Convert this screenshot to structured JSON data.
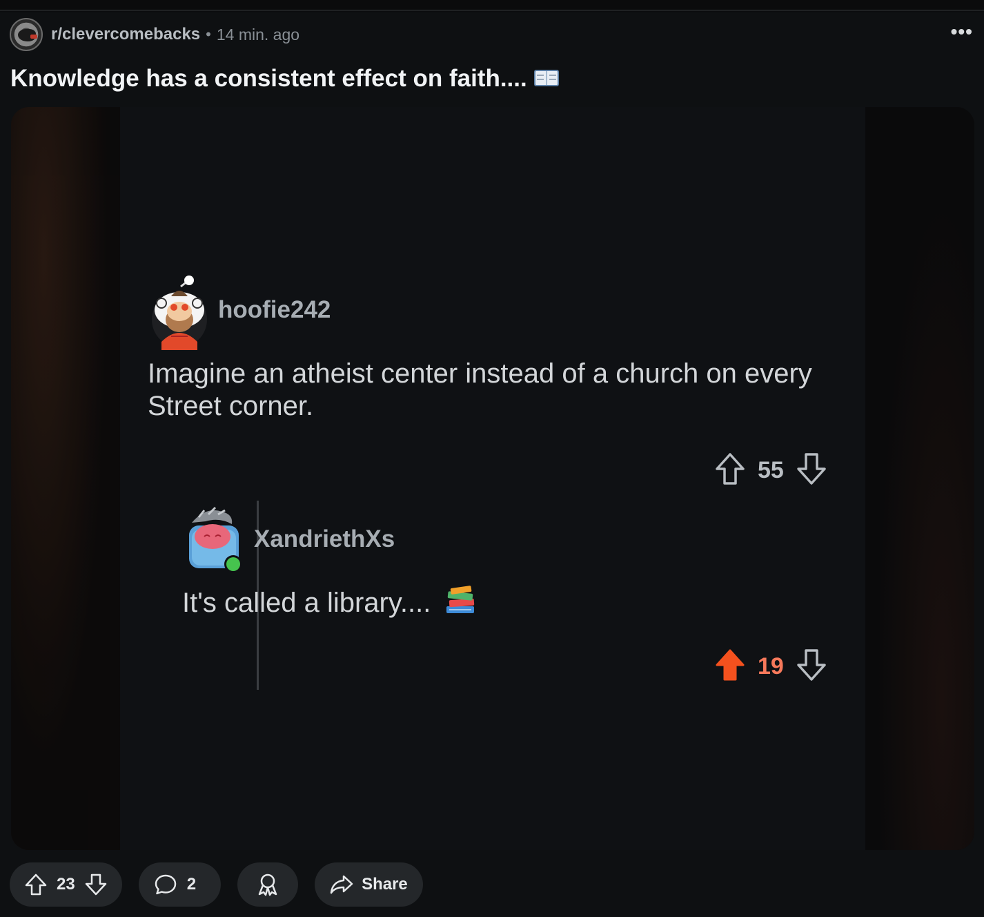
{
  "header": {
    "subreddit": "r/clevercomebacks",
    "separator": "•",
    "time": "14 min. ago",
    "more_label": "•••"
  },
  "post": {
    "title": "Knowledge has a consistent effect on faith....",
    "title_emoji_icon": "open-book-icon"
  },
  "screenshot": {
    "comment1": {
      "user": "hoofie242",
      "text_line1": "Imagine an atheist center instead of a church on every",
      "text_line2": "Street corner.",
      "votes": "55",
      "vote_state": "none"
    },
    "comment2": {
      "user": "XandriethXs",
      "text": "It's called a library....",
      "text_emoji_icon": "books-icon",
      "votes": "19",
      "vote_state": "upvoted",
      "online": true
    }
  },
  "actions": {
    "upvotes": "23",
    "comments": "2",
    "award_icon": "award-icon",
    "share_label": "Share"
  },
  "colors": {
    "accent_upvote": "#f4511e",
    "background": "#0e1012",
    "pill": "#24272a"
  }
}
